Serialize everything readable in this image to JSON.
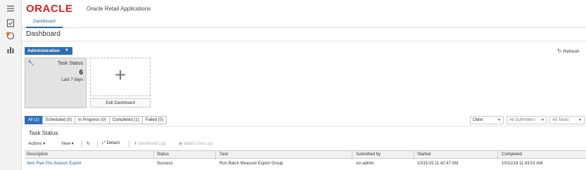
{
  "app": {
    "brand": "ORACLE",
    "title": "Oracle Retail Applications",
    "brand_color": "#e0201d",
    "accent": "#2f6fb5"
  },
  "leftbar": {
    "icons": [
      "menu-icon",
      "tasks-icon",
      "notifications-icon",
      "reports-icon"
    ]
  },
  "tabs": [
    {
      "label": "Dashboard"
    }
  ],
  "page": {
    "title": "Dashboard"
  },
  "admin_menu": {
    "label": "Administration"
  },
  "refresh": {
    "label": "Refresh"
  },
  "tile": {
    "title": "Task Status",
    "count": "6",
    "period": "Last 7 days"
  },
  "edit_dashboard": {
    "label": "Edit Dashboard"
  },
  "filters": [
    {
      "label": "All (1)",
      "active": true
    },
    {
      "label": "Scheduled (0)"
    },
    {
      "label": "In Progress (0)"
    },
    {
      "label": "Completed (1)"
    },
    {
      "label": "Failed (0)"
    }
  ],
  "selects": {
    "age": "Older",
    "submitters": "All Submitters",
    "tasks": "All Tasks"
  },
  "section": {
    "title": "Task Status"
  },
  "toolbar": {
    "actions": "Actions",
    "view": "View",
    "detach": "Detach",
    "download_log": "Download Log",
    "watch_live_log": "Watch Live Log"
  },
  "table": {
    "columns": [
      "Description",
      "Status",
      "Task",
      "Submitted by",
      "Started",
      "Completed"
    ],
    "rows": [
      {
        "description": "Item Plan Pre-Season Export",
        "status": "Success",
        "task": "Run Batch Measure Export Group",
        "submitted_by": "oci.admin",
        "started": "10/31/19 11:42:47 AM",
        "completed": "10/31/19 11:43:01 AM"
      }
    ]
  }
}
